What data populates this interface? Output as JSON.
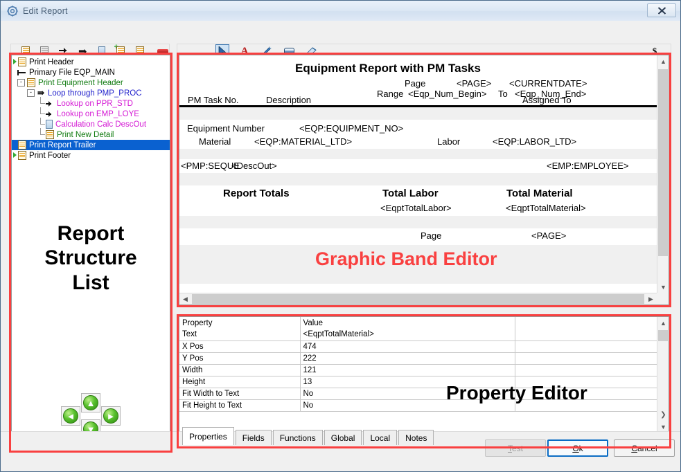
{
  "window": {
    "title": "Edit Report",
    "close_label": "✖",
    "icon": "gear-icon"
  },
  "toolbar_left": {
    "items": [
      {
        "name": "report-icon",
        "glyph": "report"
      },
      {
        "name": "report-disabled-icon",
        "glyph": "report-gray"
      },
      {
        "name": "arrow-right-icon",
        "glyph": "arrow"
      },
      {
        "name": "loop-icon",
        "glyph": "loop"
      },
      {
        "name": "calculation-icon",
        "glyph": "calc"
      },
      {
        "name": "add-report-icon",
        "glyph": "report-plus"
      },
      {
        "name": "insert-report-icon",
        "glyph": "report-insert"
      },
      {
        "name": "delete-band-icon",
        "glyph": "bar"
      }
    ]
  },
  "toolbar_right": {
    "items": [
      {
        "name": "pointer-tool-icon",
        "glyph": "pointer",
        "selected": true
      },
      {
        "name": "text-tool-icon",
        "glyph": "letter-a",
        "selected": false
      },
      {
        "name": "pencil-tool-icon",
        "glyph": "pencil",
        "selected": false
      },
      {
        "name": "box-tool-icon",
        "glyph": "box",
        "selected": false
      },
      {
        "name": "paint-tool-icon",
        "glyph": "paint",
        "selected": false
      }
    ],
    "currency_label": "$"
  },
  "tree": {
    "overlay_lines": [
      "Report",
      "Structure",
      "List"
    ],
    "items": [
      {
        "label": "Print Header",
        "color": "black",
        "depth": 0,
        "icon": "report-icon",
        "expander": "",
        "marker": true,
        "selected": false
      },
      {
        "label": "Primary File EQP_MAIN",
        "color": "black",
        "depth": 0,
        "icon": "primary-icon",
        "expander": "",
        "marker": false,
        "selected": false
      },
      {
        "label": "Print Equipment Header",
        "color": "green",
        "depth": 0,
        "icon": "report-icon",
        "expander": "-",
        "marker": false,
        "selected": false
      },
      {
        "label": "Loop through  PMP_PROC",
        "color": "blue",
        "depth": 1,
        "icon": "loop-icon",
        "expander": "-",
        "marker": false,
        "selected": false
      },
      {
        "label": "Lookup on PPR_STD",
        "color": "magenta",
        "depth": 2,
        "icon": "arrow-icon",
        "expander": "",
        "marker": false,
        "selected": false
      },
      {
        "label": "Lookup on EMP_LOYE",
        "color": "magenta",
        "depth": 2,
        "icon": "arrow-icon",
        "expander": "",
        "marker": false,
        "selected": false
      },
      {
        "label": "Calculation Calc DescOut",
        "color": "magenta",
        "depth": 2,
        "icon": "calc-icon",
        "expander": "",
        "marker": false,
        "selected": false
      },
      {
        "label": "Print New Detail",
        "color": "green",
        "depth": 2,
        "icon": "report-icon",
        "expander": "",
        "marker": false,
        "selected": false
      },
      {
        "label": "Print Report Trailer",
        "color": "black",
        "depth": 0,
        "icon": "report-icon",
        "expander": "",
        "marker": false,
        "selected": true
      },
      {
        "label": "Print Footer",
        "color": "black",
        "depth": 0,
        "icon": "report-icon",
        "expander": "",
        "marker": true,
        "selected": false
      }
    ],
    "nav": {
      "left_label": "◄",
      "up_label": "▲",
      "right_label": "►",
      "down_label": "▼"
    }
  },
  "band_editor": {
    "overlay_label": "Graphic Band Editor",
    "overlay_color": "#f94040",
    "texts": {
      "title": "Equipment Report with PM Tasks",
      "page_label": "Page",
      "page_token": "<PAGE>",
      "currentdate_token": "<CURRENTDATE>",
      "range_label": "Range",
      "range_begin": "<Eqp_Num_Begin>",
      "range_to": "To",
      "range_end": "<Eqp_Num_End>",
      "col_pm_task_no": "PM Task No.",
      "col_description": "Description",
      "col_assigned_to": "Assigned To",
      "equipment_number_label": "Equipment Number",
      "equipment_no_token": "<EQP:EQUIPMENT_NO>",
      "material_label": "Material",
      "material_token": "<EQP:MATERIAL_LTD>",
      "labor_label": "Labor",
      "labor_token": "<EQP:LABOR_LTD>",
      "pmp_seque_token": "<PMP:SEQUE",
      "descout_token": "<DescOut>",
      "employee_token": "<EMP:EMPLOYEE>",
      "report_totals_label": "Report Totals",
      "total_labor_label": "Total Labor",
      "total_material_label": "Total Material",
      "total_labor_token": "<EqptTotalLabor>",
      "total_material_token": "<EqptTotalMaterial>",
      "footer_page_label": "Page",
      "footer_page_token": "<PAGE>"
    }
  },
  "property_editor": {
    "overlay_label": "Property Editor",
    "columns": [
      "Property",
      "Value"
    ],
    "rows": [
      {
        "property": "Text",
        "value": "<EqptTotalMaterial>"
      },
      {
        "property": "X Pos",
        "value": "474"
      },
      {
        "property": "Y Pos",
        "value": "222"
      },
      {
        "property": "Width",
        "value": "121"
      },
      {
        "property": "Height",
        "value": "13"
      },
      {
        "property": "Fit Width to Text",
        "value": "No"
      },
      {
        "property": "Fit Height to Text",
        "value": "No"
      }
    ],
    "record_nav": [
      {
        "name": "first-record-button",
        "label": "|◀"
      },
      {
        "name": "prev-page-button",
        "label": "◀◀"
      },
      {
        "name": "prev-record-button",
        "label": "◀"
      },
      {
        "name": "help-button",
        "label": "?"
      },
      {
        "name": "next-record-button",
        "label": "▶"
      },
      {
        "name": "next-page-button",
        "label": "▶▶"
      },
      {
        "name": "last-record-button",
        "label": "▶|"
      }
    ],
    "hscroll_left_label": "‹",
    "tabs": [
      {
        "label": "Properties",
        "active": true
      },
      {
        "label": "Fields",
        "active": false
      },
      {
        "label": "Functions",
        "active": false
      },
      {
        "label": "Global",
        "active": false
      },
      {
        "label": "Local",
        "active": false
      },
      {
        "label": "Notes",
        "active": false
      }
    ]
  },
  "footer": {
    "test_label": "Test",
    "ok_label": "Ok",
    "cancel_label": "Cancel"
  }
}
